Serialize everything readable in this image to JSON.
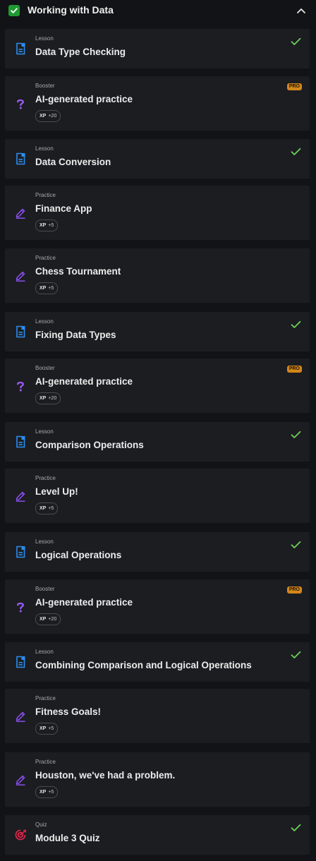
{
  "module": {
    "title": "Working with Data",
    "expanded": true,
    "completed": true
  },
  "colors": {
    "lesson_icon": "#2a8ef0",
    "practice_icon": "#8a4ff0",
    "booster_icon": "#9b5cf6",
    "quiz_icon": "#e0244a",
    "check": "#6ed05a",
    "pro_badge": "#d4861b",
    "card_bg": "#1c1d21",
    "page_bg": "#121316"
  },
  "items": [
    {
      "type": "Lesson",
      "title": "Data Type Checking",
      "icon": "lesson-icon",
      "completed": true
    },
    {
      "type": "Booster",
      "title": "AI-generated practice",
      "icon": "booster-question-icon",
      "pro": "PRO",
      "xp_label": "XP",
      "xp_value": "+20"
    },
    {
      "type": "Lesson",
      "title": "Data Conversion",
      "icon": "lesson-icon",
      "completed": true
    },
    {
      "type": "Practice",
      "title": "Finance App",
      "icon": "practice-pencil-icon",
      "xp_label": "XP",
      "xp_value": "+5"
    },
    {
      "type": "Practice",
      "title": "Chess Tournament",
      "icon": "practice-pencil-icon",
      "xp_label": "XP",
      "xp_value": "+5"
    },
    {
      "type": "Lesson",
      "title": "Fixing Data Types",
      "icon": "lesson-icon",
      "completed": true
    },
    {
      "type": "Booster",
      "title": "AI-generated practice",
      "icon": "booster-question-icon",
      "pro": "PRO",
      "xp_label": "XP",
      "xp_value": "+20"
    },
    {
      "type": "Lesson",
      "title": "Comparison Operations",
      "icon": "lesson-icon",
      "completed": true
    },
    {
      "type": "Practice",
      "title": "Level Up!",
      "icon": "practice-pencil-icon",
      "xp_label": "XP",
      "xp_value": "+5"
    },
    {
      "type": "Lesson",
      "title": "Logical Operations",
      "icon": "lesson-icon",
      "completed": true
    },
    {
      "type": "Booster",
      "title": "AI-generated practice",
      "icon": "booster-question-icon",
      "pro": "PRO",
      "xp_label": "XP",
      "xp_value": "+20"
    },
    {
      "type": "Lesson",
      "title": "Combining Comparison and Logical Operations",
      "icon": "lesson-icon",
      "completed": true
    },
    {
      "type": "Practice",
      "title": "Fitness Goals!",
      "icon": "practice-pencil-icon",
      "xp_label": "XP",
      "xp_value": "+5"
    },
    {
      "type": "Practice",
      "title": "Houston, we've had a problem.",
      "icon": "practice-pencil-icon",
      "xp_label": "XP",
      "xp_value": "+5"
    },
    {
      "type": "Quiz",
      "title": "Module 3 Quiz",
      "icon": "quiz-target-icon",
      "completed": true
    }
  ]
}
